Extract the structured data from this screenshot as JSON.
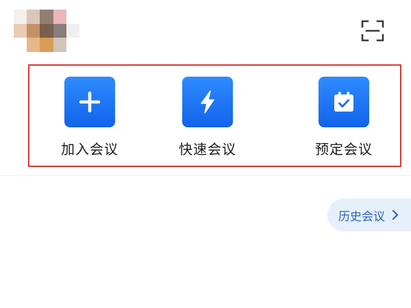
{
  "header": {
    "avatar_icon": "user-avatar",
    "scan_icon": "scan-icon"
  },
  "actions": [
    {
      "id": "join",
      "label": "加入会议",
      "icon": "plus-icon"
    },
    {
      "id": "quick",
      "label": "快速会议",
      "icon": "lightning-icon"
    },
    {
      "id": "schedule",
      "label": "预定会议",
      "icon": "calendar-check-icon"
    }
  ],
  "history": {
    "label": "历史会议",
    "icon": "chevron-right-icon"
  },
  "colors": {
    "tile_blue_top": "#2e8bff",
    "tile_blue_bottom": "#1263ea",
    "highlight_border": "#d53a36",
    "history_bg": "#e6f0fb",
    "history_text": "#2a63b8"
  }
}
